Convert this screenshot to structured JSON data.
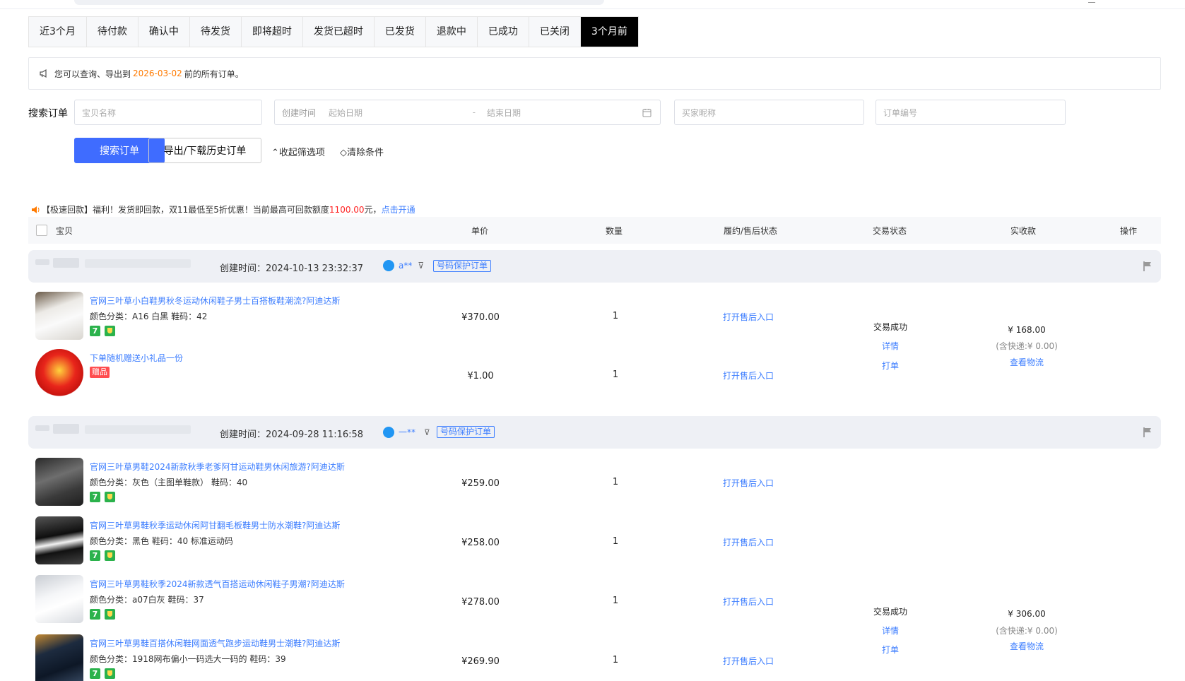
{
  "tabs": [
    "近3个月",
    "待付款",
    "确认中",
    "待发货",
    "即将超时",
    "发货已超时",
    "已发货",
    "退款中",
    "已成功",
    "已关闭",
    "3个月前"
  ],
  "active_tab_index": 10,
  "notice": {
    "prefix": "您可以查询、导出到",
    "date": "2026-03-02",
    "suffix": "前的所有订单。"
  },
  "search": {
    "label": "搜索订单",
    "item_placeholder": "宝贝名称",
    "created_label": "创建时间",
    "start_placeholder": "起始日期",
    "date_sep": "-",
    "end_placeholder": "结束日期",
    "buyer_placeholder": "买家昵称",
    "order_no_placeholder": "订单编号",
    "search_button": "搜索订单",
    "export_button": "导出/下载历史订单",
    "collapse_link": "收起筛选项",
    "clear_link": "清除条件"
  },
  "promo": {
    "text": "【极速回款】福利！发货即回款，双11最低至5折优惠！当前最高可回款额度",
    "amount": "1100.00",
    "unit": "元，",
    "link": "点击开通"
  },
  "table_header": {
    "item": "宝贝",
    "price": "单价",
    "qty": "数量",
    "after_sale": "履约/售后状态",
    "trade_status": "交易状态",
    "paid": "实收款",
    "action": "操作"
  },
  "colors": {
    "accent": "#3d7eff",
    "primary_button": "#3f6cff",
    "date_orange": "#ff7a00",
    "promo_red": "#f22222",
    "badge_green": "#2bb24c"
  },
  "orders": [
    {
      "created": "创建时间：2024-10-13 23:32:37",
      "buyer": "a**",
      "tag": "号码保护订单",
      "status": "交易成功",
      "detail": "详情",
      "print": "打单",
      "amount": "¥ 168.00",
      "shipping": "(含快递:¥ 0.00)",
      "logistics": "查看物流",
      "items": [
        {
          "title": "官网三叶草小白鞋男秋冬运动休闲鞋子男士百搭板鞋潮流?阿迪达斯",
          "attr": "颜色分类：A16 白黑   鞋码：42",
          "price": "¥370.00",
          "qty": "1",
          "after": "打开售后入口"
        },
        {
          "title": "下单随机赠送小礼品一份",
          "gift_tag": "赠品",
          "price": "¥1.00",
          "qty": "1",
          "after": "打开售后入口"
        }
      ]
    },
    {
      "created": "创建时间：2024-09-28 11:16:58",
      "buyer": "一**",
      "tag": "号码保护订单",
      "status": "交易成功",
      "detail": "详情",
      "print": "打单",
      "amount": "¥ 306.00",
      "shipping": "(含快递:¥ 0.00)",
      "logistics": "查看物流",
      "items": [
        {
          "title": "官网三叶草男鞋2024新款秋季老爹阿甘运动鞋男休闲旅游?阿迪达斯",
          "attr": "颜色分类：灰色（主图单鞋款）  鞋码：40",
          "price": "¥259.00",
          "qty": "1",
          "after": "打开售后入口"
        },
        {
          "title": "官网三叶草男鞋秋季运动休闲阿甘翻毛板鞋男士防水潮鞋?阿迪达斯",
          "attr": "颜色分类：黑色  鞋码：40 标准运动码",
          "price": "¥258.00",
          "qty": "1",
          "after": "打开售后入口"
        },
        {
          "title": "官网三叶草男鞋秋季2024新款透气百搭运动休闲鞋子男潮?阿迪达斯",
          "attr": "颜色分类：a07白灰  鞋码：37",
          "price": "¥278.00",
          "qty": "1",
          "after": "打开售后入口"
        },
        {
          "title": "官网三叶草男鞋百搭休闲鞋网面透气跑步运动鞋男士潮鞋?阿迪达斯",
          "attr": "颜色分类：1918网布偏小一码选大一码的  鞋码：39",
          "price": "¥269.90",
          "qty": "1",
          "after": "打开售后入口"
        }
      ]
    }
  ]
}
